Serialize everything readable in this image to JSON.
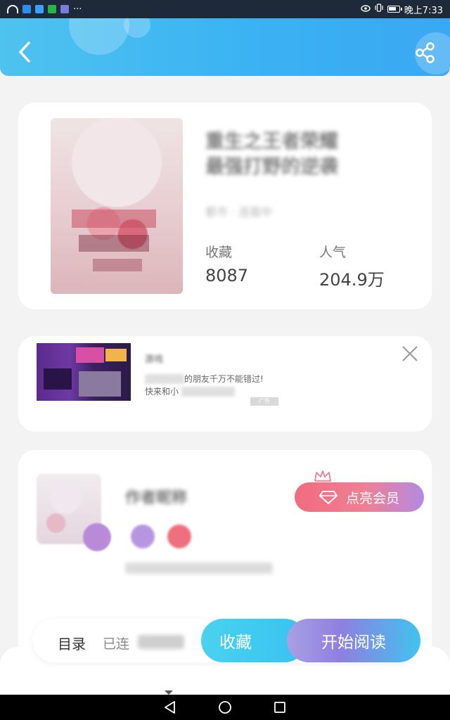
{
  "status_bar": {
    "time": "晚上7:33",
    "more": "···"
  },
  "book": {
    "title_line1": "重生之王者荣耀",
    "title_line2": "最强打野的逆袭",
    "meta": "都市 · 连载中",
    "favorites_label": "收藏",
    "favorites_value": "8087",
    "popularity_label": "人气",
    "popularity_value": "204.9万"
  },
  "ad": {
    "title": "游戏",
    "line1": "的朋友千万不能错过!",
    "line2_prefix": "快来和小",
    "badge": "广告"
  },
  "author": {
    "name": "作者昵称",
    "vip_button": "点亮会员"
  },
  "actions": {
    "catalog": "目录",
    "serial_prefix": "已连",
    "favorite": "收藏",
    "start_reading": "开始阅读"
  },
  "colors": {
    "header_blue": "#3bb2f3",
    "fav_cyan": "#38c2f0",
    "vip_pink": "#f06c7e",
    "read_purple": "#8f7fe0"
  },
  "icons": {
    "back": "chevron-left-icon",
    "share": "share-icon",
    "close": "close-icon",
    "diamond": "diamond-icon",
    "crown": "crown-icon"
  }
}
